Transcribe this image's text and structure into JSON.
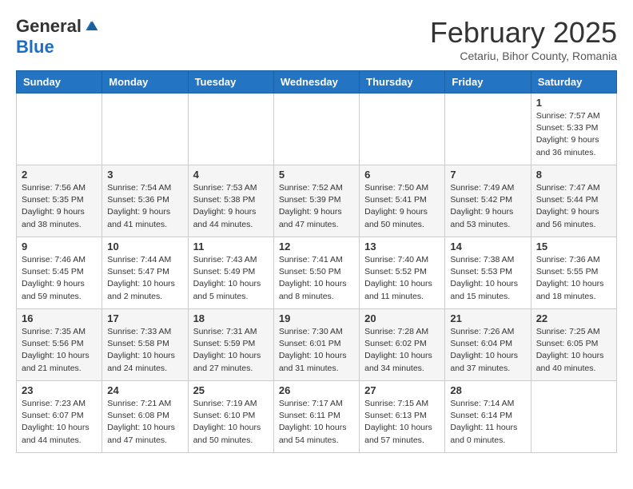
{
  "header": {
    "logo_general": "General",
    "logo_blue": "Blue",
    "title": "February 2025",
    "location": "Cetariu, Bihor County, Romania"
  },
  "calendar": {
    "days_of_week": [
      "Sunday",
      "Monday",
      "Tuesday",
      "Wednesday",
      "Thursday",
      "Friday",
      "Saturday"
    ],
    "weeks": [
      [
        {
          "day": "",
          "info": ""
        },
        {
          "day": "",
          "info": ""
        },
        {
          "day": "",
          "info": ""
        },
        {
          "day": "",
          "info": ""
        },
        {
          "day": "",
          "info": ""
        },
        {
          "day": "",
          "info": ""
        },
        {
          "day": "1",
          "info": "Sunrise: 7:57 AM\nSunset: 5:33 PM\nDaylight: 9 hours\nand 36 minutes."
        }
      ],
      [
        {
          "day": "2",
          "info": "Sunrise: 7:56 AM\nSunset: 5:35 PM\nDaylight: 9 hours\nand 38 minutes."
        },
        {
          "day": "3",
          "info": "Sunrise: 7:54 AM\nSunset: 5:36 PM\nDaylight: 9 hours\nand 41 minutes."
        },
        {
          "day": "4",
          "info": "Sunrise: 7:53 AM\nSunset: 5:38 PM\nDaylight: 9 hours\nand 44 minutes."
        },
        {
          "day": "5",
          "info": "Sunrise: 7:52 AM\nSunset: 5:39 PM\nDaylight: 9 hours\nand 47 minutes."
        },
        {
          "day": "6",
          "info": "Sunrise: 7:50 AM\nSunset: 5:41 PM\nDaylight: 9 hours\nand 50 minutes."
        },
        {
          "day": "7",
          "info": "Sunrise: 7:49 AM\nSunset: 5:42 PM\nDaylight: 9 hours\nand 53 minutes."
        },
        {
          "day": "8",
          "info": "Sunrise: 7:47 AM\nSunset: 5:44 PM\nDaylight: 9 hours\nand 56 minutes."
        }
      ],
      [
        {
          "day": "9",
          "info": "Sunrise: 7:46 AM\nSunset: 5:45 PM\nDaylight: 9 hours\nand 59 minutes."
        },
        {
          "day": "10",
          "info": "Sunrise: 7:44 AM\nSunset: 5:47 PM\nDaylight: 10 hours\nand 2 minutes."
        },
        {
          "day": "11",
          "info": "Sunrise: 7:43 AM\nSunset: 5:49 PM\nDaylight: 10 hours\nand 5 minutes."
        },
        {
          "day": "12",
          "info": "Sunrise: 7:41 AM\nSunset: 5:50 PM\nDaylight: 10 hours\nand 8 minutes."
        },
        {
          "day": "13",
          "info": "Sunrise: 7:40 AM\nSunset: 5:52 PM\nDaylight: 10 hours\nand 11 minutes."
        },
        {
          "day": "14",
          "info": "Sunrise: 7:38 AM\nSunset: 5:53 PM\nDaylight: 10 hours\nand 15 minutes."
        },
        {
          "day": "15",
          "info": "Sunrise: 7:36 AM\nSunset: 5:55 PM\nDaylight: 10 hours\nand 18 minutes."
        }
      ],
      [
        {
          "day": "16",
          "info": "Sunrise: 7:35 AM\nSunset: 5:56 PM\nDaylight: 10 hours\nand 21 minutes."
        },
        {
          "day": "17",
          "info": "Sunrise: 7:33 AM\nSunset: 5:58 PM\nDaylight: 10 hours\nand 24 minutes."
        },
        {
          "day": "18",
          "info": "Sunrise: 7:31 AM\nSunset: 5:59 PM\nDaylight: 10 hours\nand 27 minutes."
        },
        {
          "day": "19",
          "info": "Sunrise: 7:30 AM\nSunset: 6:01 PM\nDaylight: 10 hours\nand 31 minutes."
        },
        {
          "day": "20",
          "info": "Sunrise: 7:28 AM\nSunset: 6:02 PM\nDaylight: 10 hours\nand 34 minutes."
        },
        {
          "day": "21",
          "info": "Sunrise: 7:26 AM\nSunset: 6:04 PM\nDaylight: 10 hours\nand 37 minutes."
        },
        {
          "day": "22",
          "info": "Sunrise: 7:25 AM\nSunset: 6:05 PM\nDaylight: 10 hours\nand 40 minutes."
        }
      ],
      [
        {
          "day": "23",
          "info": "Sunrise: 7:23 AM\nSunset: 6:07 PM\nDaylight: 10 hours\nand 44 minutes."
        },
        {
          "day": "24",
          "info": "Sunrise: 7:21 AM\nSunset: 6:08 PM\nDaylight: 10 hours\nand 47 minutes."
        },
        {
          "day": "25",
          "info": "Sunrise: 7:19 AM\nSunset: 6:10 PM\nDaylight: 10 hours\nand 50 minutes."
        },
        {
          "day": "26",
          "info": "Sunrise: 7:17 AM\nSunset: 6:11 PM\nDaylight: 10 hours\nand 54 minutes."
        },
        {
          "day": "27",
          "info": "Sunrise: 7:15 AM\nSunset: 6:13 PM\nDaylight: 10 hours\nand 57 minutes."
        },
        {
          "day": "28",
          "info": "Sunrise: 7:14 AM\nSunset: 6:14 PM\nDaylight: 11 hours\nand 0 minutes."
        },
        {
          "day": "",
          "info": ""
        }
      ]
    ]
  }
}
